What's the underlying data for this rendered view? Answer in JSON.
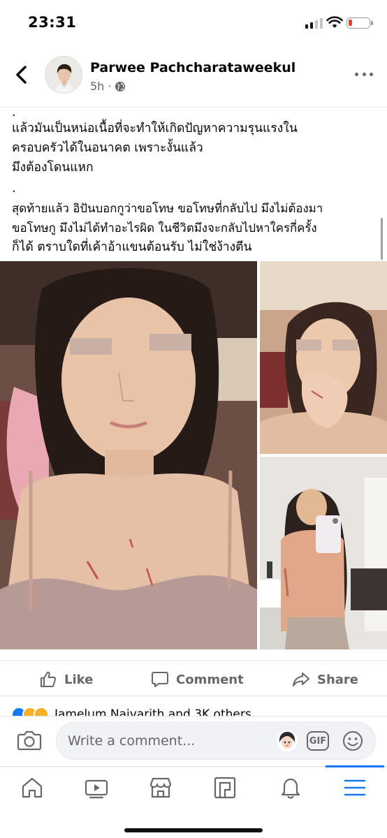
{
  "status_bar": {
    "time": "23:31",
    "battery_level_fraction": 0.12,
    "battery_color": "#ff3b30"
  },
  "post": {
    "author": "Parwee Pachcharataweekul",
    "time_ago": "5h",
    "separator": "·",
    "audience_icon": "globe-icon",
    "text_lines": [
      ".",
      "แล้วมันเป็นหน่อเนื้อที่จะทำให้เกิดปัญหาความรุนแรงใน",
      "ครอบครัวได้ในอนาคต เพราะงั้นแล้ว",
      "มึงต้องโดนแหก",
      ".",
      "สุดท้ายแล้ว อิปันบอกกูว่าขอโทษ ขอโทษที่กลับไป มึงไม่ต้องมา",
      "ขอโทษกู มึงไม่ได้ทำอะไรผิด ในชีวิตมึงจะกลับไปหาใครกี่ครั้ง",
      "ก็ได้ ตราบใดที่เค้าอ้าแขนต้อนรับ ไม่ใช่ง้างตีน"
    ]
  },
  "actions": {
    "like": "Like",
    "comment": "Comment",
    "share": "Share"
  },
  "reactions": {
    "summary": "Jamelum Naivarith and 3K others"
  },
  "comment_bar": {
    "placeholder": "Write a comment...",
    "gif_label": "GIF"
  },
  "nav": {
    "items": [
      "home-icon",
      "watch-icon",
      "marketplace-icon",
      "pages-icon",
      "notifications-icon",
      "menu-icon"
    ],
    "active": "menu-icon",
    "accent": "#1877f2"
  },
  "colors": {
    "secondary_text": "#65676b",
    "divider": "#e5e5e5"
  }
}
